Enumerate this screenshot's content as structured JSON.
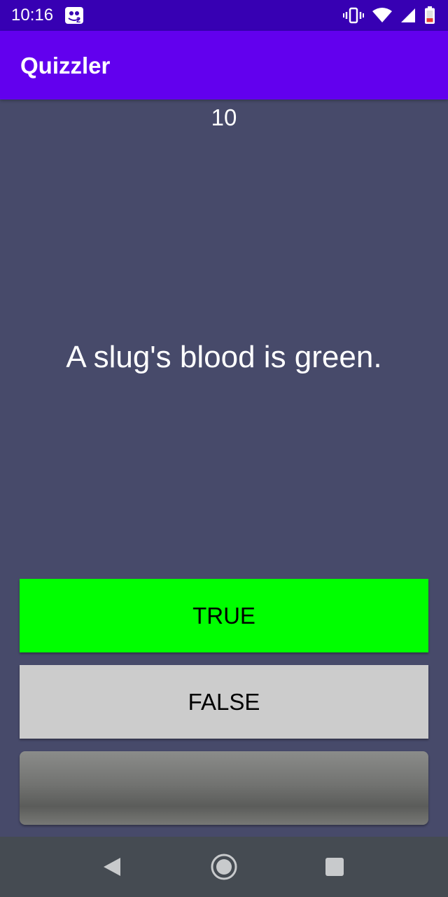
{
  "status_bar": {
    "time": "10:16",
    "icons": [
      "notification-game-icon",
      "vibrate-icon",
      "wifi-icon",
      "signal-icon",
      "battery-low-icon"
    ]
  },
  "app_bar": {
    "title": "Quizzler",
    "color": "#6200ee"
  },
  "quiz": {
    "score": "10",
    "question": "A slug's blood is green.",
    "true_label": "TRUE",
    "false_label": "FALSE",
    "next_label": "",
    "true_color": "#00ff00",
    "false_color": "#cccccc",
    "background": "#474a6a"
  },
  "nav_bar": {
    "icons": [
      "back-icon",
      "home-icon",
      "recent-apps-icon"
    ]
  }
}
